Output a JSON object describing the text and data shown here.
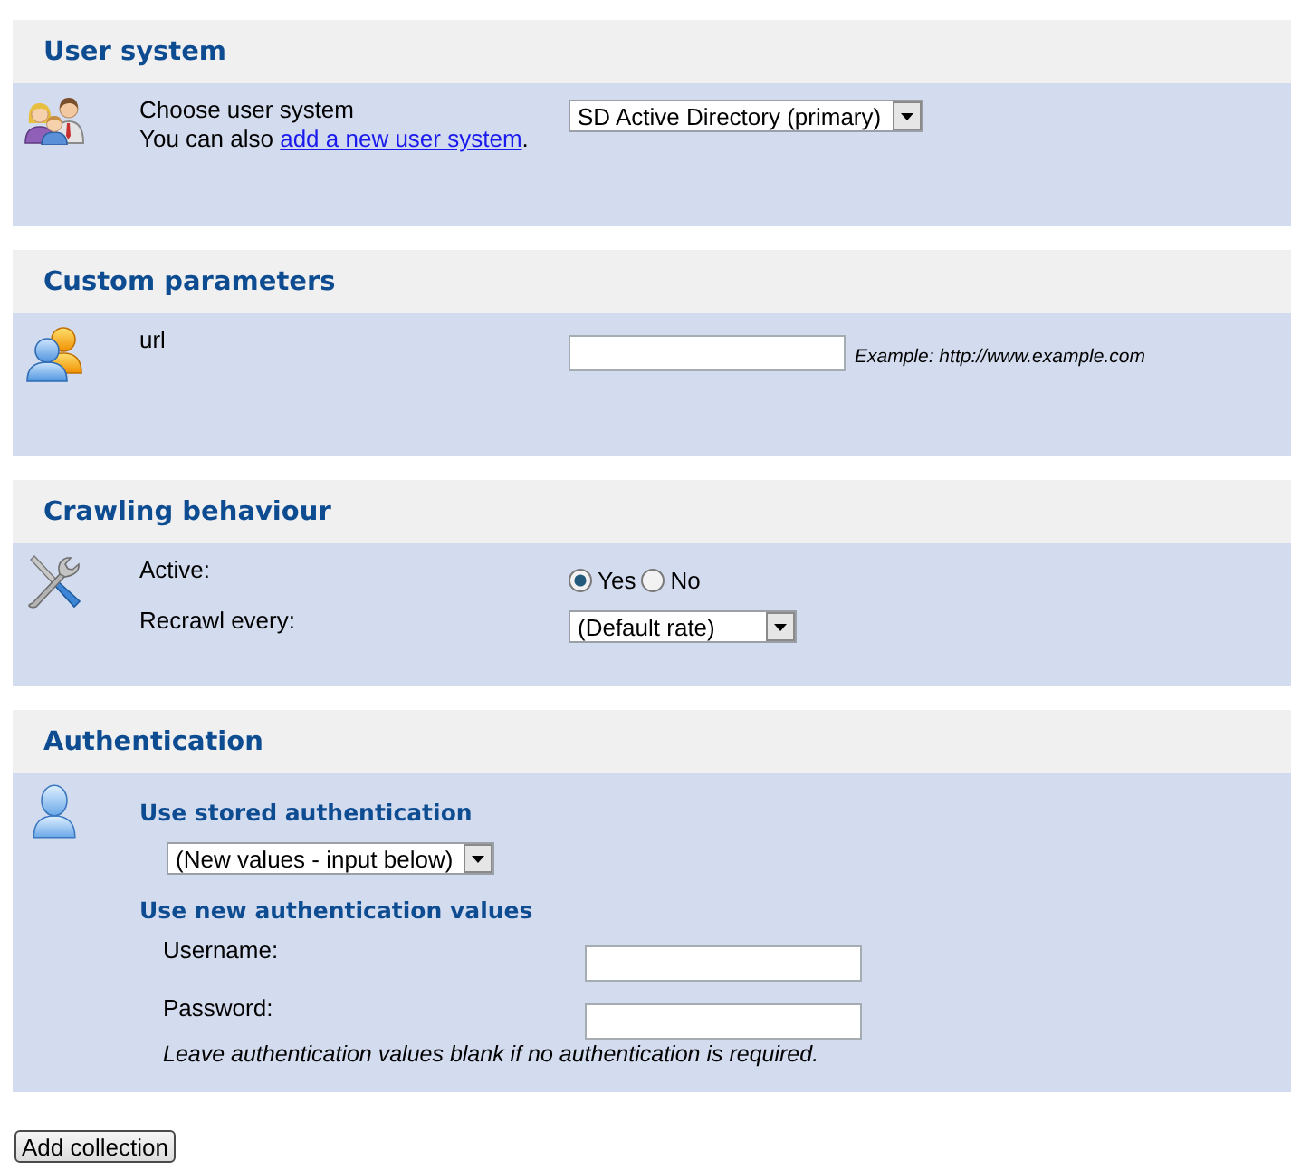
{
  "sections": [
    {
      "kind": "user_system",
      "title": "User system",
      "rows": [
        {
          "kind": "select",
          "label": "Choose user system",
          "help": {
            "before": "You can also ",
            "link": "add a new user system",
            "after": "."
          },
          "value": "SD Active Directory (primary)"
        }
      ]
    },
    {
      "kind": "custom_parameters",
      "title": "Custom parameters",
      "rows": [
        {
          "kind": "text",
          "label": "url",
          "example": "Example: http://www.example.com"
        }
      ]
    },
    {
      "kind": "crawling",
      "title": "Crawling behaviour",
      "rows": [
        {
          "kind": "radio",
          "label": "Active:",
          "options": [
            {
              "label": "Yes",
              "selected": true
            },
            {
              "label": "No",
              "selected": false
            }
          ]
        },
        {
          "kind": "select",
          "label": "Recrawl every:",
          "value": "(Default rate)"
        }
      ]
    },
    {
      "kind": "authentication",
      "title": "Authentication",
      "rows": [
        {
          "kind": "group",
          "heading": "Use stored authentication",
          "rows": [
            {
              "kind": "select",
              "value": "(New values - input below)"
            }
          ]
        },
        {
          "kind": "group",
          "heading": "Use new authentication values",
          "rows": [
            {
              "kind": "text",
              "label": "Username:"
            },
            {
              "kind": "password",
              "label": "Password:"
            },
            {
              "kind": "note",
              "text": "Leave authentication values blank if no authentication is required."
            }
          ]
        }
      ]
    }
  ],
  "button": {
    "label": "Add collection"
  }
}
